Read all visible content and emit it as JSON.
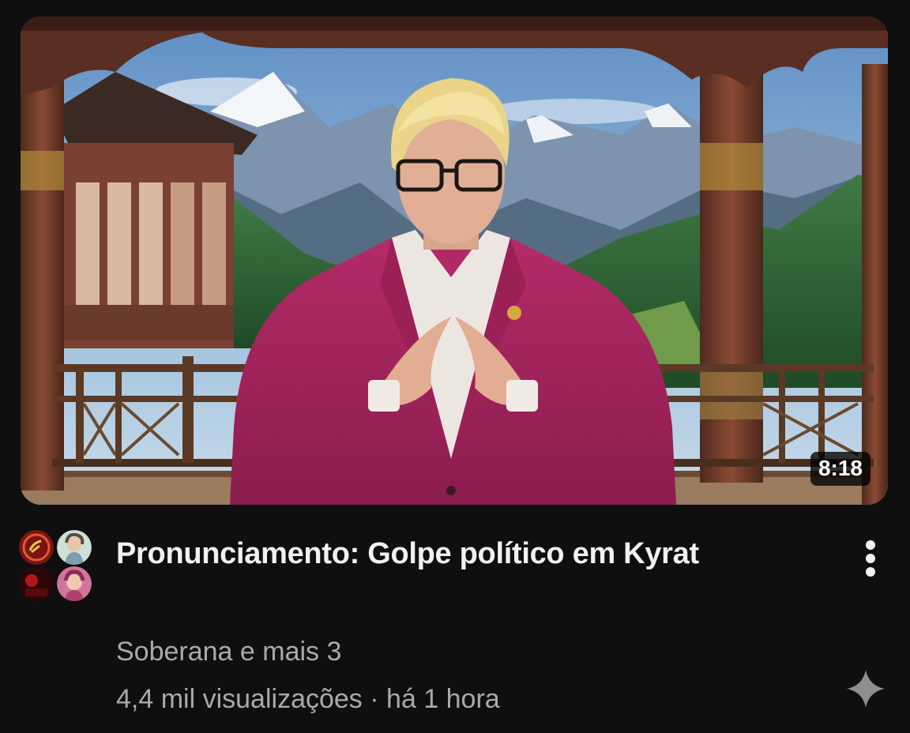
{
  "video": {
    "duration": "8:18",
    "title": "Pronunciamento: Golpe político em Kyrat",
    "channel": "Soberana e mais 3",
    "views": "4,4 mil visualizações",
    "separator": "·",
    "age": "há 1 hora"
  },
  "icons": {
    "more": "vertical-dots-icon",
    "sparkle": "sparkle-icon"
  },
  "colors": {
    "background": "#0f0f0f",
    "primary_text": "#f1f1f1",
    "secondary_text": "#aaaaaa",
    "suit": "#a8225f"
  }
}
